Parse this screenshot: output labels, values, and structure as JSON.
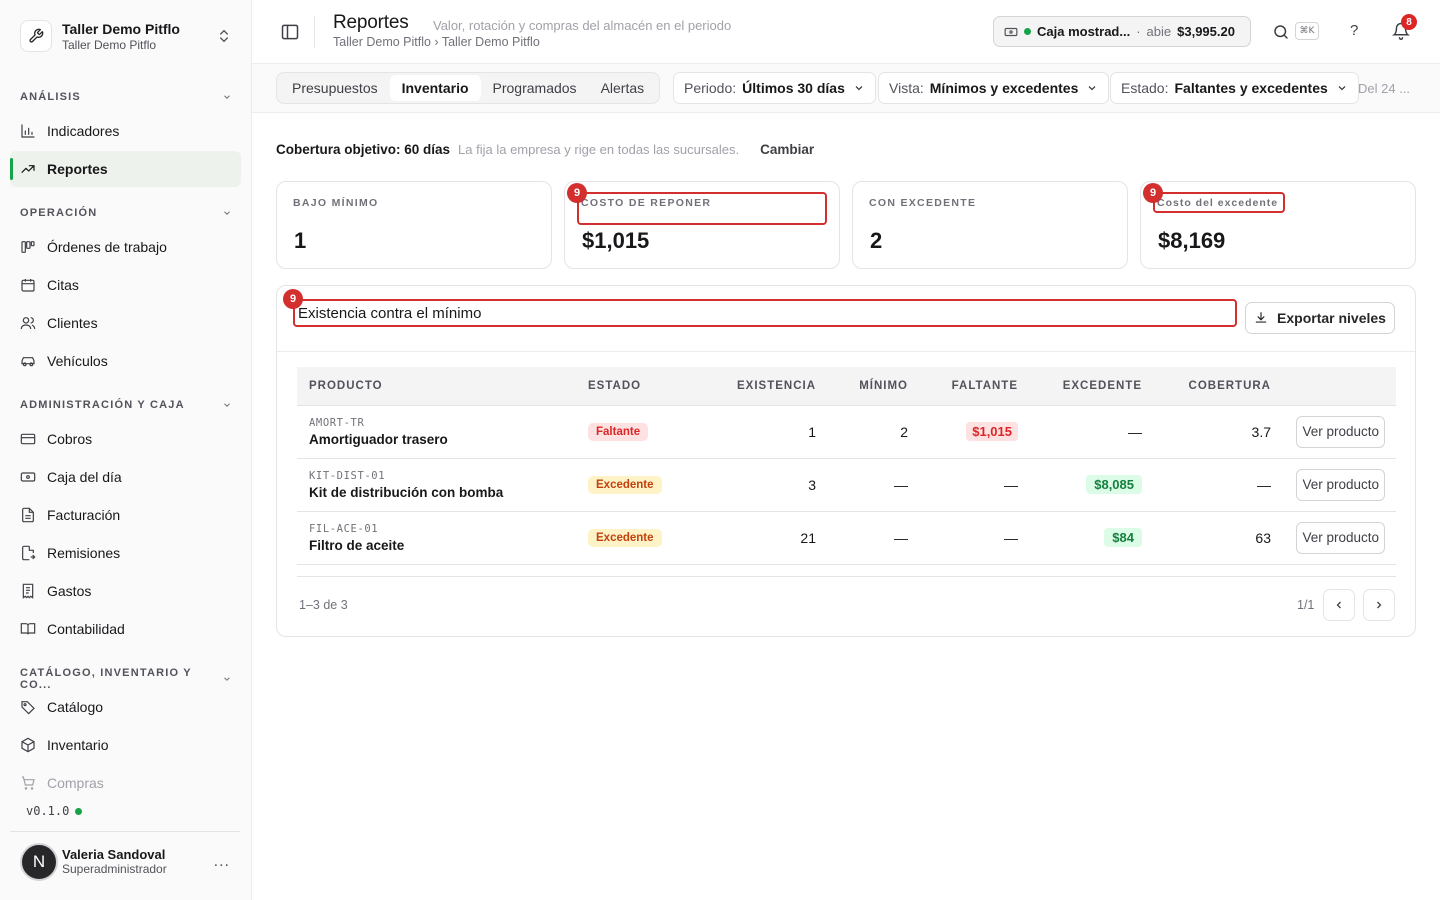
{
  "workspace": {
    "name": "Taller Demo Pitflo",
    "sub": "Taller Demo Pitflo"
  },
  "sidebar": {
    "sections": [
      {
        "label": "ANÁLISIS"
      },
      {
        "label": "OPERACIÓN"
      },
      {
        "label": "ADMINISTRACIÓN Y CAJA"
      },
      {
        "label": "CATÁLOGO, INVENTARIO Y CO..."
      }
    ],
    "items": [
      {
        "label": "Indicadores",
        "icon": "bar-chart-icon"
      },
      {
        "label": "Reportes",
        "icon": "trend-icon"
      },
      {
        "label": "Órdenes de trabajo",
        "icon": "kanban-icon"
      },
      {
        "label": "Citas",
        "icon": "calendar-icon"
      },
      {
        "label": "Clientes",
        "icon": "users-icon"
      },
      {
        "label": "Vehículos",
        "icon": "car-icon"
      },
      {
        "label": "Cobros",
        "icon": "card-icon"
      },
      {
        "label": "Caja del día",
        "icon": "banknote-icon"
      },
      {
        "label": "Facturación",
        "icon": "file-icon"
      },
      {
        "label": "Remisiones",
        "icon": "file-out-icon"
      },
      {
        "label": "Gastos",
        "icon": "receipt-icon"
      },
      {
        "label": "Contabilidad",
        "icon": "book-icon"
      },
      {
        "label": "Catálogo",
        "icon": "tags-icon"
      },
      {
        "label": "Inventario",
        "icon": "package-icon"
      },
      {
        "label": "Compras",
        "icon": "cart-icon"
      }
    ],
    "version": "v0.1.0"
  },
  "user": {
    "initial": "N",
    "name": "Valeria Sandoval",
    "role": "Superadministrador",
    "more": "..."
  },
  "header": {
    "title": "Reportes",
    "subtitle": "Valor, rotación y compras del almacén en el periodo",
    "breadcrumb": "Taller Demo Pitflo › Taller Demo Pitflo",
    "cash": {
      "name": "Caja mostrad...",
      "sep": "·",
      "status": "abie",
      "amount": "$3,995.20"
    },
    "shortcut": "⌘K",
    "help": "?",
    "notifications": "8"
  },
  "filters": {
    "tabs": [
      {
        "label": "Presupuestos"
      },
      {
        "label": "Inventario"
      },
      {
        "label": "Programados"
      },
      {
        "label": "Alertas"
      }
    ],
    "periodo": {
      "label": "Periodo:",
      "value": "Últimos 30 días"
    },
    "vista": {
      "label": "Vista:",
      "value": "Mínimos y excedentes"
    },
    "estado": {
      "label": "Estado:",
      "value": "Faltantes y excedentes"
    },
    "date": "Del 24 ..."
  },
  "coverage": {
    "label": "Cobertura objetivo: 60 días",
    "note": "La fija la empresa y rige en todas las sucursales.",
    "action": "Cambiar"
  },
  "cards": [
    {
      "label": "BAJO MÍNIMO",
      "value": "1"
    },
    {
      "label": "COSTO DE REPONER",
      "value": "$1,015"
    },
    {
      "label": "CON EXCEDENTE",
      "value": "2"
    },
    {
      "label": "Costo del excedente",
      "value": "$8,169"
    }
  ],
  "markers": {
    "m1": "9",
    "m2": "9",
    "m3": "9"
  },
  "panel": {
    "title": "Existencia contra el mínimo",
    "export": "Exportar niveles",
    "columns": [
      "PRODUCTO",
      "ESTADO",
      "EXISTENCIA",
      "MÍNIMO",
      "FALTANTE",
      "EXCEDENTE",
      "COBERTURA"
    ],
    "rows": [
      {
        "sku": "AMORT-TR",
        "name": "Amortiguador trasero",
        "status": "Faltante",
        "stock": "1",
        "min": "2",
        "short": "$1,015",
        "excess": "—",
        "coverage": "3.7",
        "action": "Ver producto"
      },
      {
        "sku": "KIT-DIST-01",
        "name": "Kit de distribución con bomba",
        "status": "Excedente",
        "stock": "3",
        "min": "—",
        "short": "—",
        "excess": "$8,085",
        "coverage": "—",
        "action": "Ver producto"
      },
      {
        "sku": "FIL-ACE-01",
        "name": "Filtro de aceite",
        "status": "Excedente",
        "stock": "21",
        "min": "—",
        "short": "—",
        "excess": "$84",
        "coverage": "63",
        "action": "Ver producto"
      }
    ],
    "range": "1–3 de 3",
    "page": "1/1"
  },
  "colors": {
    "accent": "#16a34a",
    "danger": "#dc2626",
    "marker": "#d32f2f"
  }
}
